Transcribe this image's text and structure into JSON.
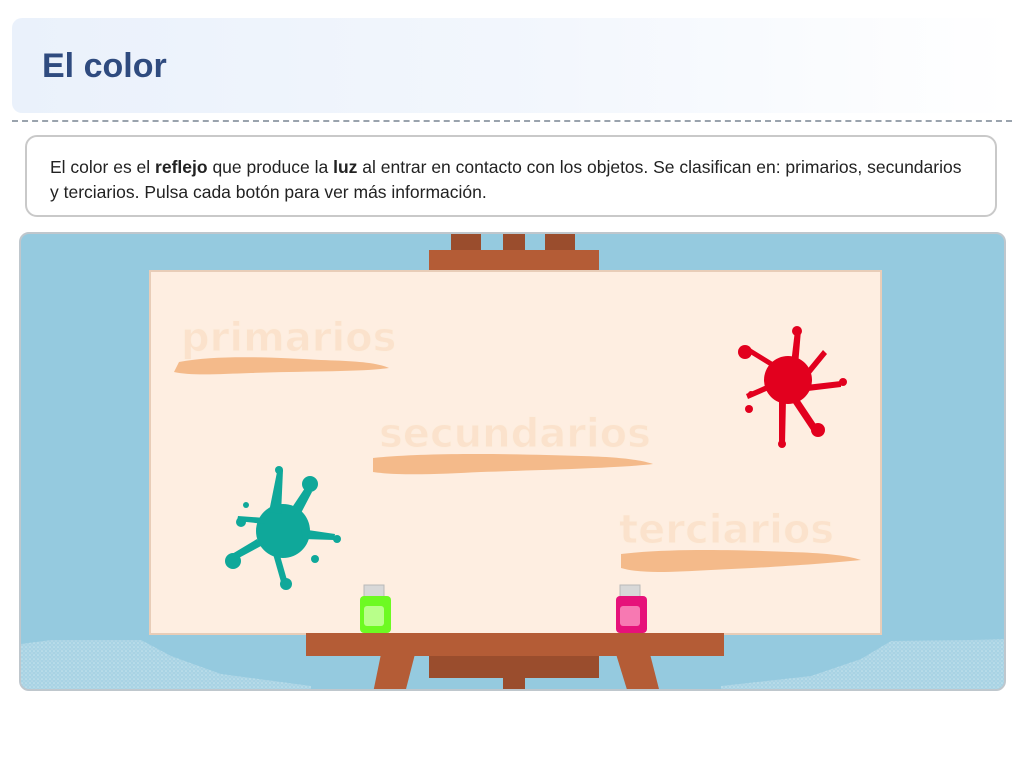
{
  "page": {
    "title": "El color"
  },
  "intro": {
    "part1": "El color es el ",
    "bold1": "reflejo",
    "part2": " que produce la ",
    "bold2": "luz",
    "part3": " al entrar en contacto con los objetos. Se clasifican en: primarios, secundarios y terciarios. Pulsa cada botón para ver más información."
  },
  "canvas": {
    "buttons": {
      "primarios": "primarios",
      "secundarios": "secundarios",
      "terciarios": "terciarios"
    },
    "decorations": {
      "left_splat": "paint-splat",
      "right_splat": "paint-splat",
      "left_bottle": "paint-bottle",
      "right_bottle": "paint-bottle"
    }
  },
  "colors": {
    "title": "#2f4b7f",
    "scene_background": "#95cadf",
    "canvas": "#feeee1",
    "easel": "#b45c36",
    "easel_dark": "#9a4d2d",
    "brush_stroke": "#f2b07a",
    "splat_teal": "#0fa89a",
    "splat_red": "#e2001e",
    "bottle_green": "#6dfa22",
    "bottle_pink": "#e6127a"
  }
}
